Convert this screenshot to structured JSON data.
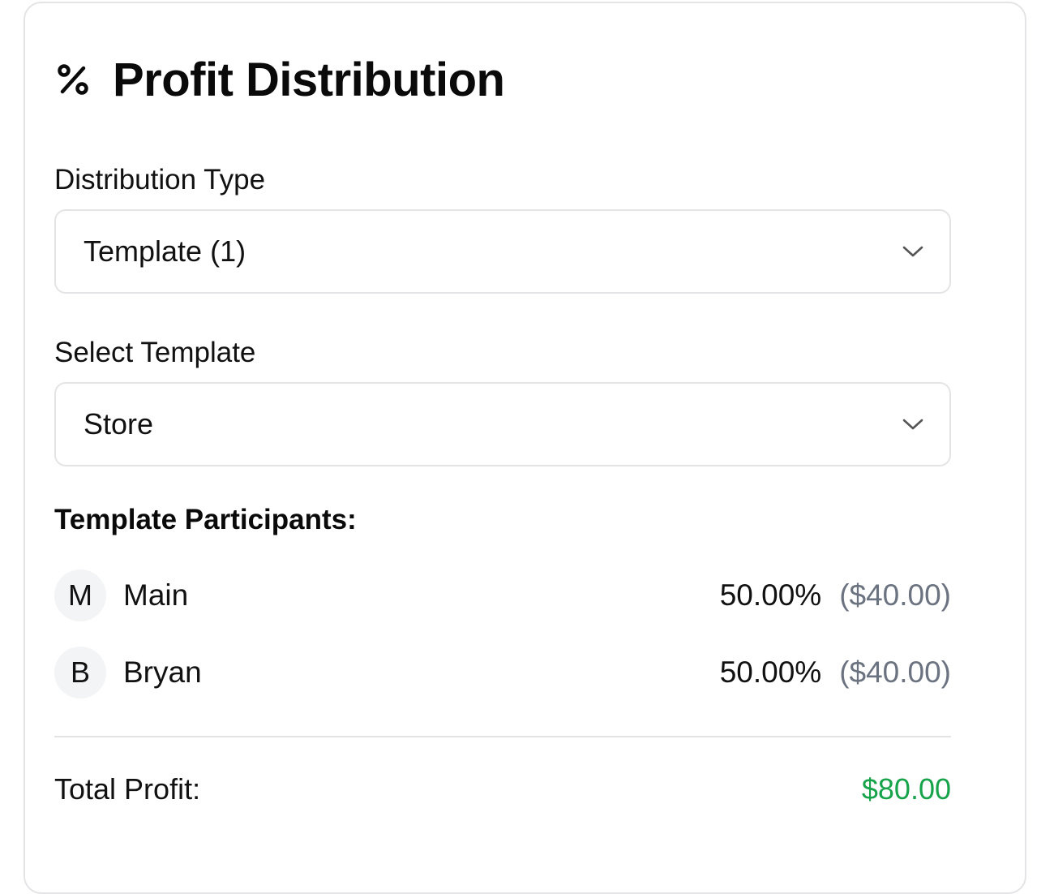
{
  "header": {
    "icon": "percent-icon",
    "title": "Profit Distribution"
  },
  "distribution_type": {
    "label": "Distribution Type",
    "selected": "Template (1)",
    "icon": "chevron-down-icon"
  },
  "select_template": {
    "label": "Select Template",
    "selected": "Store",
    "icon": "chevron-down-icon"
  },
  "participants": {
    "title": "Template Participants:",
    "items": [
      {
        "initial": "M",
        "name": "Main",
        "percent": "50.00%",
        "amount": "($40.00)"
      },
      {
        "initial": "B",
        "name": "Bryan",
        "percent": "50.00%",
        "amount": "($40.00)"
      }
    ]
  },
  "total": {
    "label": "Total Profit:",
    "value": "$80.00"
  },
  "colors": {
    "total_value": "#16a34a",
    "muted": "#6b7280",
    "border": "#e4e4e7",
    "avatar_bg": "#f3f4f6"
  }
}
